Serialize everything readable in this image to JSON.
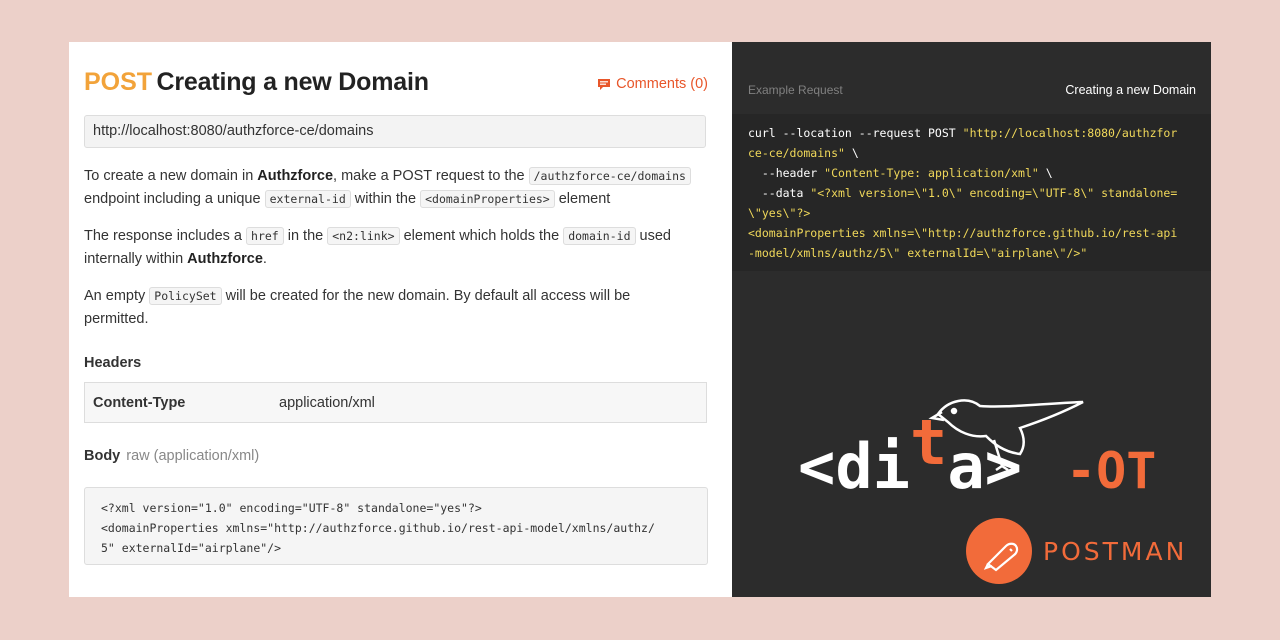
{
  "doc": {
    "method": "POST",
    "title": "Creating a new Domain",
    "comments_label": "Comments (0)",
    "url": "http://localhost:8080/authzforce-ce/domains",
    "p1": {
      "t1": "To create a new domain in ",
      "b1": "Authzforce",
      "t2": ", make a POST request to the ",
      "c1": "/authzforce-ce/domains",
      "t3": " endpoint including a unique ",
      "c2": "external-id",
      "t4": " within the ",
      "c3": "<domainProperties>",
      "t5": " element"
    },
    "p2": {
      "t1": "The response includes a ",
      "c1": "href",
      "t2": " in the ",
      "c2": "<n2:link>",
      "t3": " element which holds the ",
      "c3": "domain-id",
      "t4": " used internally within ",
      "b1": "Authzforce",
      "t5": "."
    },
    "p3": {
      "t1": "An empty ",
      "c1": "PolicySet",
      "t2": " will be created for the new domain. By default all access will be permitted."
    },
    "headers_title": "Headers",
    "headers": [
      {
        "key": "Content-Type",
        "value": "application/xml"
      }
    ],
    "body_title": "Body",
    "body_sub": "raw (application/xml)",
    "body_code": "<?xml version=\"1.0\" encoding=\"UTF-8\" standalone=\"yes\"?>\n<domainProperties xmlns=\"http://authzforce.github.io/rest-api-model/xmlns/authz/\n5\" externalId=\"airplane\"/>"
  },
  "example": {
    "label": "Example Request",
    "name": "Creating a new Domain",
    "line1_cmd": "curl --location --request POST ",
    "line1_str": "\"http://localhost:8080/authzfor",
    "line2_str": "ce-ce/domains\"",
    "line2_tail": " \\",
    "line3_cmd": "  --header ",
    "line3_str": "\"Content-Type: application/xml\"",
    "line3_tail": " \\",
    "line4_cmd": "  --data ",
    "line4_str": "\"<?xml version=\\\"1.0\\\" encoding=\\\"UTF-8\\\" standalone=",
    "line5_str": "\\\"yes\\\"?>",
    "line6_str": "<domainProperties xmlns=\\\"http://authzforce.github.io/rest-api",
    "line7_str": "-model/xmlns/authz/5\\\" externalId=\\\"airplane\\\"/>\""
  },
  "logos": {
    "dita_text_1": "<di",
    "dita_text_t": "t",
    "dita_text_2": "a>",
    "dita_suffix": "-OT",
    "postman_word": "POSTMAN"
  },
  "colors": {
    "accent_orange": "#f26b3a",
    "method_orange": "#f2a33a",
    "code_string": "#f0d85a",
    "right_bg": "#2c2c2c"
  }
}
